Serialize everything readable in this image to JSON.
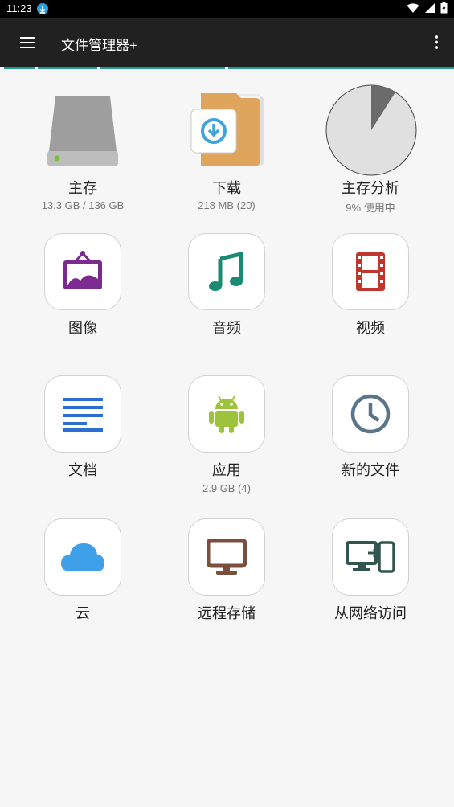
{
  "status_bar": {
    "time": "11:23"
  },
  "app_bar": {
    "title": "文件管理器+"
  },
  "items": [
    {
      "label": "主存",
      "sub": "13.3 GB / 136 GB",
      "icon": "hard-drive-icon"
    },
    {
      "label": "下载",
      "sub": "218 MB (20)",
      "icon": "download-folder-icon"
    },
    {
      "label": "主存分析",
      "sub": "9% 使用中",
      "icon": "pie-chart-icon",
      "usage_percent": 9
    },
    {
      "label": "图像",
      "icon": "image-icon",
      "color": "#7b2a8f"
    },
    {
      "label": "音频",
      "icon": "music-note-icon",
      "color": "#1b8a73"
    },
    {
      "label": "视频",
      "icon": "film-icon",
      "color": "#c0362c"
    },
    {
      "label": "文档",
      "icon": "document-icon",
      "color": "#2c6fd1"
    },
    {
      "label": "应用",
      "sub": "2.9 GB (4)",
      "icon": "android-icon",
      "color": "#9cc33b"
    },
    {
      "label": "新的文件",
      "icon": "clock-icon",
      "color": "#5a748a"
    },
    {
      "label": "云",
      "icon": "cloud-icon",
      "color": "#3ea0e8"
    },
    {
      "label": "远程存储",
      "icon": "monitor-icon",
      "color": "#7a4f3e"
    },
    {
      "label": "从网络访问",
      "icon": "network-devices-icon",
      "color": "#33554f"
    }
  ],
  "colors": {
    "accent": "#1b9e8d",
    "appbar": "#212121"
  }
}
